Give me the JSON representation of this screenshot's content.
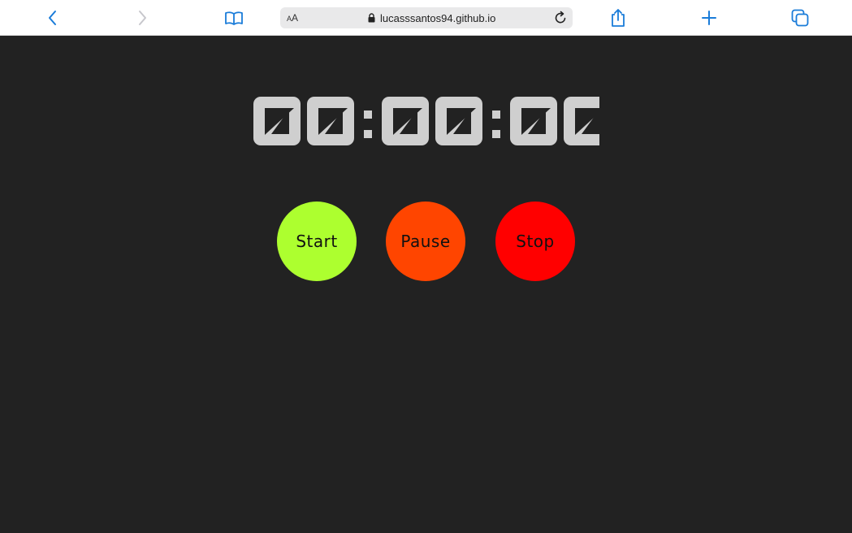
{
  "browser": {
    "address_bar": {
      "text_size_small": "A",
      "text_size_large": "A",
      "url": "lucasssantos94.github.io"
    },
    "icons": {
      "back": "chevron-left-icon",
      "forward": "chevron-right-icon",
      "bookmarks": "book-icon",
      "lock": "lock-icon",
      "reload": "reload-icon",
      "share": "share-icon",
      "new_tab": "plus-icon",
      "tabs": "tabs-icon"
    },
    "colors": {
      "accent": "#1a7cd9",
      "disabled": "#c7c7cc"
    }
  },
  "stopwatch": {
    "display": "00:00:00",
    "digit_color": "#cfcfcf",
    "background": "#222222",
    "buttons": {
      "start": {
        "label": "Start",
        "color": "#adff2f"
      },
      "pause": {
        "label": "Pause",
        "color": "#ff4500"
      },
      "stop": {
        "label": "Stop",
        "color": "#ff0000"
      }
    }
  }
}
